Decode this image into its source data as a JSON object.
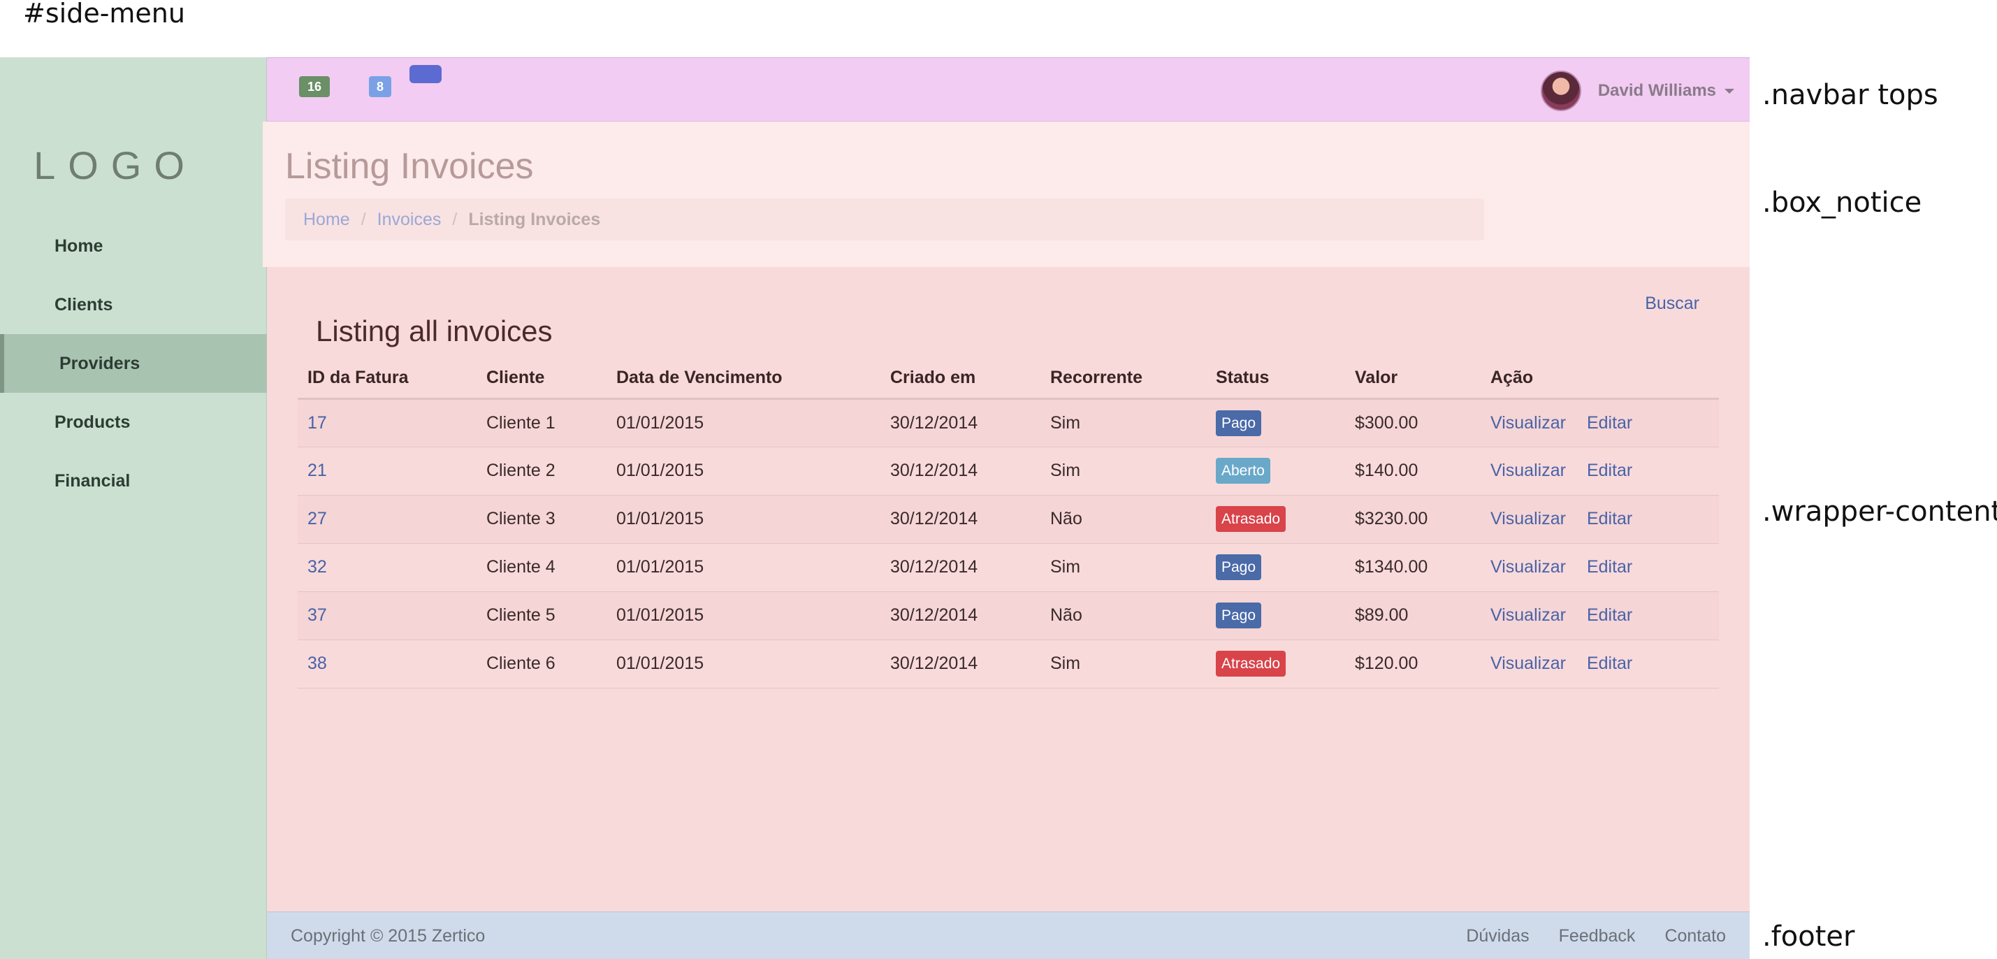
{
  "annotations": {
    "side_menu": "#side-menu",
    "navbar": ".navbar tops",
    "box_notice": ".box_notice",
    "wrapper": ".wrapper-content",
    "footer": ".footer"
  },
  "sidebar": {
    "logo": "LOGO",
    "items": [
      {
        "label": "Home",
        "active": false
      },
      {
        "label": "Clients",
        "active": false
      },
      {
        "label": "Providers",
        "active": true
      },
      {
        "label": "Products",
        "active": false
      },
      {
        "label": "Financial",
        "active": false
      }
    ]
  },
  "navbar": {
    "badges": [
      {
        "value": "16",
        "color": "#6b8f66"
      },
      {
        "value": "8",
        "color": "#7aa1e6"
      },
      {
        "value": "",
        "color": "#5c6bd1"
      }
    ],
    "user_name": "David Williams",
    "avatar_icon": "user-avatar"
  },
  "notice": {
    "title": "Listing Invoices",
    "breadcrumb": [
      "Home",
      "Invoices",
      "Listing Invoices"
    ]
  },
  "content": {
    "search_link": "Buscar",
    "heading": "Listing all invoices",
    "columns": [
      "ID da Fatura",
      "Cliente",
      "Data de Vencimento",
      "Criado em",
      "Recorrente",
      "Status",
      "Valor",
      "Ação"
    ],
    "rows": [
      {
        "id": "17",
        "client": "Cliente 1",
        "due": "01/01/2015",
        "created": "30/12/2014",
        "recurring": "Sim",
        "status": "Pago",
        "status_color": "#4a6aa8",
        "value": "$300.00",
        "view": "Visualizar",
        "edit": "Editar"
      },
      {
        "id": "21",
        "client": "Cliente 2",
        "due": "01/01/2015",
        "created": "30/12/2014",
        "recurring": "Sim",
        "status": "Aberto",
        "status_color": "#6aa8c9",
        "value": "$140.00",
        "view": "Visualizar",
        "edit": "Editar"
      },
      {
        "id": "27",
        "client": "Cliente 3",
        "due": "01/01/2015",
        "created": "30/12/2014",
        "recurring": "Não",
        "status": "Atrasado",
        "status_color": "#d9434a",
        "value": "$3230.00",
        "view": "Visualizar",
        "edit": "Editar"
      },
      {
        "id": "32",
        "client": "Cliente 4",
        "due": "01/01/2015",
        "created": "30/12/2014",
        "recurring": "Sim",
        "status": "Pago",
        "status_color": "#4a6aa8",
        "value": "$1340.00",
        "view": "Visualizar",
        "edit": "Editar"
      },
      {
        "id": "37",
        "client": "Cliente 5",
        "due": "01/01/2015",
        "created": "30/12/2014",
        "recurring": "Não",
        "status": "Pago",
        "status_color": "#4a6aa8",
        "value": "$89.00",
        "view": "Visualizar",
        "edit": "Editar"
      },
      {
        "id": "38",
        "client": "Cliente 6",
        "due": "01/01/2015",
        "created": "30/12/2014",
        "recurring": "Sim",
        "status": "Atrasado",
        "status_color": "#d9434a",
        "value": "$120.00",
        "view": "Visualizar",
        "edit": "Editar"
      }
    ]
  },
  "footer": {
    "copyright": "Copyright © 2015 Zertico",
    "links": [
      "Dúvidas",
      "Feedback",
      "Contato"
    ]
  },
  "colors": {
    "sidebar_bg": "#cce0d2",
    "navbar_bg": "#f2ccf2",
    "notice_bg": "#fdeaea",
    "wrapper_bg": "#f9dada",
    "footer_bg": "#cfdbea",
    "link": "#4863a8"
  }
}
